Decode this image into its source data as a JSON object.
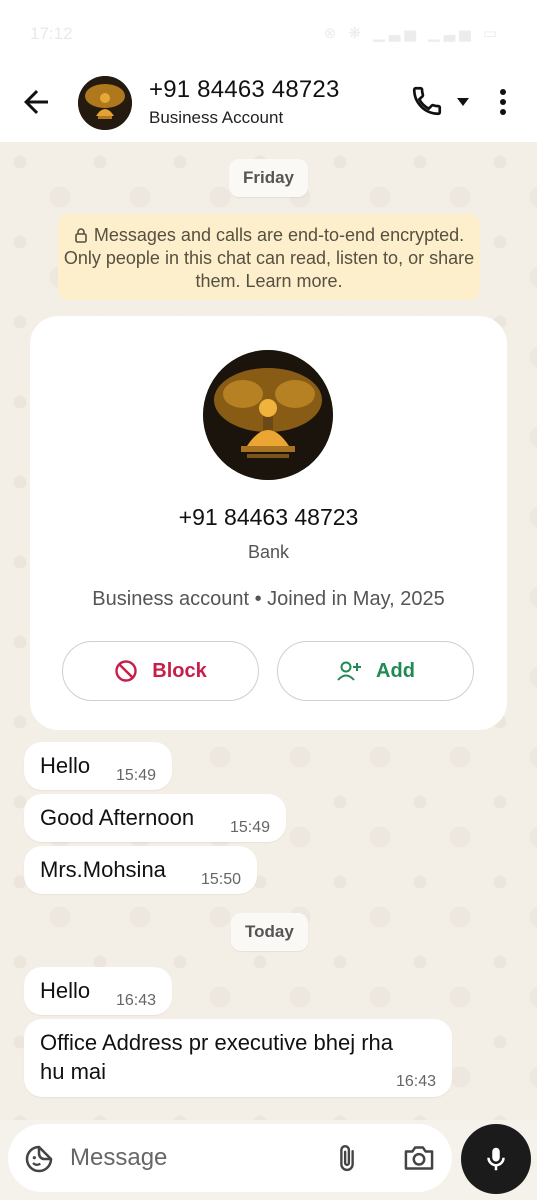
{
  "status_bar": {
    "time": "17:12",
    "icons_text": "⊗ ❋ ▁▃▅ ▁▃▅ ▭"
  },
  "header": {
    "title": "+91 84463 48723",
    "subtitle": "Business Account"
  },
  "dates": {
    "first": "Friday",
    "second": "Today"
  },
  "encryption_notice": "Messages and calls are end-to-end encrypted. Only people in this chat can read, listen to, or share them. Learn more.",
  "profile_card": {
    "phone": "+91 84463 48723",
    "label": "Bank",
    "meta": "Business account • Joined in May, 2025",
    "block_label": "Block",
    "add_label": "Add"
  },
  "messages": [
    {
      "text": "Hello",
      "time": "15:49"
    },
    {
      "text": "Good Afternoon",
      "time": "15:49"
    },
    {
      "text": "Mrs.Mohsina",
      "time": "15:50"
    },
    {
      "text": "Hello",
      "time": "16:43"
    },
    {
      "text_line1": "Office Address pr executive bhej rha",
      "text_line2": "hu mai",
      "time": "16:43"
    }
  ],
  "input": {
    "placeholder": "Message"
  },
  "colors": {
    "block": "#c81e4a",
    "add": "#1f8a55",
    "notice_bg": "#fdefcc",
    "mic_bg": "#1b1b1b"
  },
  "icons": [
    "arrow-left-icon",
    "phone-icon",
    "caret-down-icon",
    "more-vert-icon",
    "lock-icon",
    "block-icon",
    "add-person-icon",
    "sticker-icon",
    "paperclip-icon",
    "camera-icon",
    "microphone-icon"
  ]
}
